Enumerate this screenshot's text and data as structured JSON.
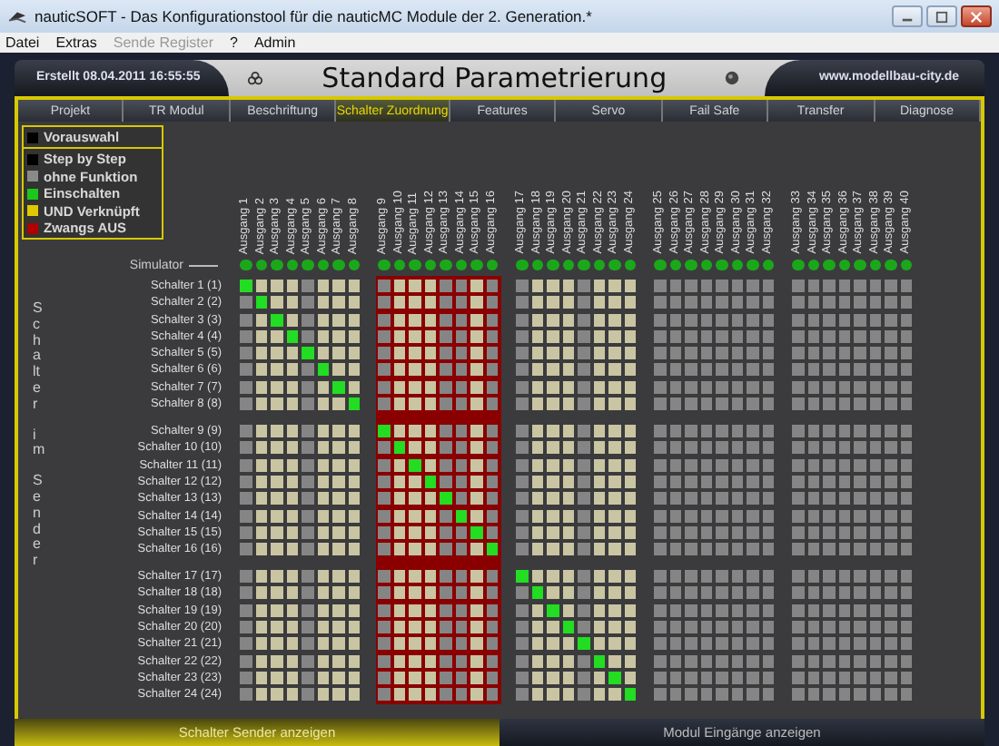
{
  "window": {
    "title": "nauticSOFT - Das Konfigurationstool für die nauticMC Module der 2. Generation.*"
  },
  "menu": [
    {
      "label": "Datei",
      "disabled": false
    },
    {
      "label": "Extras",
      "disabled": false
    },
    {
      "label": "Sende Register",
      "disabled": true
    },
    {
      "label": "?",
      "disabled": false
    },
    {
      "label": "Admin",
      "disabled": false
    }
  ],
  "header": {
    "created": "Erstellt 08.04.2011 16:55:55",
    "title": "Standard Parametrierung",
    "website": "www.modellbau-city.de"
  },
  "tabs": [
    {
      "label": "Projekt",
      "selected": false
    },
    {
      "label": "TR Modul",
      "selected": false
    },
    {
      "label": "Beschriftung",
      "selected": false
    },
    {
      "label": "Schalter Zuordnung",
      "selected": true
    },
    {
      "label": "Features",
      "selected": false
    },
    {
      "label": "Servo",
      "selected": false
    },
    {
      "label": "Fail Safe",
      "selected": false
    },
    {
      "label": "Transfer",
      "selected": false
    },
    {
      "label": "Diagnose",
      "selected": false
    }
  ],
  "legend_top": {
    "label": "Vorauswahl",
    "color": "#000000"
  },
  "legend": [
    {
      "label": "Step by Step",
      "color": "#000000"
    },
    {
      "label": "ohne Funktion",
      "color": "#8a8a8a"
    },
    {
      "label": "Einschalten",
      "color": "#19c819"
    },
    {
      "label": "UND Verknüpft",
      "color": "#e0c800"
    },
    {
      "label": "Zwangs AUS",
      "color": "#b00000"
    }
  ],
  "simulator_label": "Simulator",
  "side_label": [
    "Schalter",
    "im",
    "Sender"
  ],
  "column_groups": [
    {
      "forced_off": false,
      "columns": [
        {
          "label": "Ausgang 1",
          "enabled": false,
          "simulator_on": true
        },
        {
          "label": "Ausgang 2",
          "enabled": true,
          "simulator_on": true
        },
        {
          "label": "Ausgang 3",
          "enabled": true,
          "simulator_on": true
        },
        {
          "label": "Ausgang 4",
          "enabled": true,
          "simulator_on": true
        },
        {
          "label": "Ausgang 5",
          "enabled": false,
          "simulator_on": true
        },
        {
          "label": "Ausgang 6",
          "enabled": true,
          "simulator_on": true
        },
        {
          "label": "Ausgang 7",
          "enabled": true,
          "simulator_on": true
        },
        {
          "label": "Ausgang 8",
          "enabled": true,
          "simulator_on": true
        }
      ]
    },
    {
      "forced_off": true,
      "columns": [
        {
          "label": "Ausgang 9",
          "enabled": false,
          "simulator_on": true
        },
        {
          "label": "Ausgang 10",
          "enabled": true,
          "simulator_on": true
        },
        {
          "label": "Ausgang 11",
          "enabled": true,
          "simulator_on": true
        },
        {
          "label": "Ausgang 12",
          "enabled": true,
          "simulator_on": true
        },
        {
          "label": "Ausgang 13",
          "enabled": false,
          "simulator_on": true
        },
        {
          "label": "Ausgang 14",
          "enabled": false,
          "simulator_on": true
        },
        {
          "label": "Ausgang 15",
          "enabled": true,
          "simulator_on": true
        },
        {
          "label": "Ausgang 16",
          "enabled": false,
          "simulator_on": true
        }
      ]
    },
    {
      "forced_off": false,
      "columns": [
        {
          "label": "Ausgang 17",
          "enabled": false,
          "simulator_on": true
        },
        {
          "label": "Ausgang 18",
          "enabled": true,
          "simulator_on": true
        },
        {
          "label": "Ausgang 19",
          "enabled": true,
          "simulator_on": true
        },
        {
          "label": "Ausgang 20",
          "enabled": true,
          "simulator_on": true
        },
        {
          "label": "Ausgang 21",
          "enabled": false,
          "simulator_on": true
        },
        {
          "label": "Ausgang 22",
          "enabled": true,
          "simulator_on": true
        },
        {
          "label": "Ausgang 23",
          "enabled": true,
          "simulator_on": true
        },
        {
          "label": "Ausgang 24",
          "enabled": true,
          "simulator_on": true
        }
      ]
    },
    {
      "forced_off": false,
      "columns": [
        {
          "label": "Ausgang 25",
          "enabled": false,
          "simulator_on": true
        },
        {
          "label": "Ausgang 26",
          "enabled": false,
          "simulator_on": true
        },
        {
          "label": "Ausgang 27",
          "enabled": false,
          "simulator_on": true
        },
        {
          "label": "Ausgang 28",
          "enabled": false,
          "simulator_on": true
        },
        {
          "label": "Ausgang 29",
          "enabled": false,
          "simulator_on": true
        },
        {
          "label": "Ausgang 30",
          "enabled": false,
          "simulator_on": true
        },
        {
          "label": "Ausgang 31",
          "enabled": false,
          "simulator_on": true
        },
        {
          "label": "Ausgang 32",
          "enabled": false,
          "simulator_on": true
        }
      ]
    },
    {
      "forced_off": false,
      "columns": [
        {
          "label": "Ausgang 33",
          "enabled": false,
          "simulator_on": true
        },
        {
          "label": "Ausgang 34",
          "enabled": false,
          "simulator_on": true
        },
        {
          "label": "Ausgang 35",
          "enabled": false,
          "simulator_on": true
        },
        {
          "label": "Ausgang 36",
          "enabled": false,
          "simulator_on": true
        },
        {
          "label": "Ausgang 37",
          "enabled": false,
          "simulator_on": true
        },
        {
          "label": "Ausgang 38",
          "enabled": false,
          "simulator_on": true
        },
        {
          "label": "Ausgang 39",
          "enabled": false,
          "simulator_on": true
        },
        {
          "label": "Ausgang 40",
          "enabled": false,
          "simulator_on": true
        }
      ]
    }
  ],
  "row_groups": [
    {
      "rows": [
        {
          "label": "Schalter 1 (1)",
          "on": [
            true,
            false,
            false,
            false,
            false,
            false,
            false,
            false,
            false,
            false,
            false,
            false,
            false,
            false,
            false,
            false,
            false,
            false,
            false,
            false,
            false,
            false,
            false,
            false,
            false,
            false,
            false,
            false,
            false,
            false,
            false,
            false,
            false,
            false,
            false,
            false,
            false,
            false,
            false,
            false
          ]
        },
        {
          "label": "Schalter 2 (2)",
          "on": [
            false,
            true,
            false,
            false,
            false,
            false,
            false,
            false,
            false,
            false,
            false,
            false,
            false,
            false,
            false,
            false,
            false,
            false,
            false,
            false,
            false,
            false,
            false,
            false,
            false,
            false,
            false,
            false,
            false,
            false,
            false,
            false,
            false,
            false,
            false,
            false,
            false,
            false,
            false,
            false
          ]
        },
        {
          "label": "Schalter 3 (3)",
          "on": [
            false,
            false,
            true,
            false,
            false,
            false,
            false,
            false,
            false,
            false,
            false,
            false,
            false,
            false,
            false,
            false,
            false,
            false,
            false,
            false,
            false,
            false,
            false,
            false,
            false,
            false,
            false,
            false,
            false,
            false,
            false,
            false,
            false,
            false,
            false,
            false,
            false,
            false,
            false,
            false
          ]
        },
        {
          "label": "Schalter 4 (4)",
          "on": [
            false,
            false,
            false,
            true,
            false,
            false,
            false,
            false,
            false,
            false,
            false,
            false,
            false,
            false,
            false,
            false,
            false,
            false,
            false,
            false,
            false,
            false,
            false,
            false,
            false,
            false,
            false,
            false,
            false,
            false,
            false,
            false,
            false,
            false,
            false,
            false,
            false,
            false,
            false,
            false
          ]
        },
        {
          "label": "Schalter 5 (5)",
          "on": [
            false,
            false,
            false,
            false,
            true,
            false,
            false,
            false,
            false,
            false,
            false,
            false,
            false,
            false,
            false,
            false,
            false,
            false,
            false,
            false,
            false,
            false,
            false,
            false,
            false,
            false,
            false,
            false,
            false,
            false,
            false,
            false,
            false,
            false,
            false,
            false,
            false,
            false,
            false,
            false
          ]
        },
        {
          "label": "Schalter 6 (6)",
          "on": [
            false,
            false,
            false,
            false,
            false,
            true,
            false,
            false,
            false,
            false,
            false,
            false,
            false,
            false,
            false,
            false,
            false,
            false,
            false,
            false,
            false,
            false,
            false,
            false,
            false,
            false,
            false,
            false,
            false,
            false,
            false,
            false,
            false,
            false,
            false,
            false,
            false,
            false,
            false,
            false
          ]
        },
        {
          "label": "Schalter 7 (7)",
          "on": [
            false,
            false,
            false,
            false,
            false,
            false,
            true,
            false,
            false,
            false,
            false,
            false,
            false,
            false,
            false,
            false,
            false,
            false,
            false,
            false,
            false,
            false,
            false,
            false,
            false,
            false,
            false,
            false,
            false,
            false,
            false,
            false,
            false,
            false,
            false,
            false,
            false,
            false,
            false,
            false
          ]
        },
        {
          "label": "Schalter 8 (8)",
          "on": [
            false,
            false,
            false,
            false,
            false,
            false,
            false,
            true,
            false,
            false,
            false,
            false,
            false,
            false,
            false,
            false,
            false,
            false,
            false,
            false,
            false,
            false,
            false,
            false,
            false,
            false,
            false,
            false,
            false,
            false,
            false,
            false,
            false,
            false,
            false,
            false,
            false,
            false,
            false,
            false
          ]
        }
      ]
    },
    {
      "rows": [
        {
          "label": "Schalter 9 (9)",
          "on": [
            false,
            false,
            false,
            false,
            false,
            false,
            false,
            false,
            true,
            false,
            false,
            false,
            false,
            false,
            false,
            false,
            false,
            false,
            false,
            false,
            false,
            false,
            false,
            false,
            false,
            false,
            false,
            false,
            false,
            false,
            false,
            false,
            false,
            false,
            false,
            false,
            false,
            false,
            false,
            false
          ]
        },
        {
          "label": "Schalter 10 (10)",
          "on": [
            false,
            false,
            false,
            false,
            false,
            false,
            false,
            false,
            false,
            true,
            false,
            false,
            false,
            false,
            false,
            false,
            false,
            false,
            false,
            false,
            false,
            false,
            false,
            false,
            false,
            false,
            false,
            false,
            false,
            false,
            false,
            false,
            false,
            false,
            false,
            false,
            false,
            false,
            false,
            false
          ]
        },
        {
          "label": "Schalter 11 (11)",
          "on": [
            false,
            false,
            false,
            false,
            false,
            false,
            false,
            false,
            false,
            false,
            true,
            false,
            false,
            false,
            false,
            false,
            false,
            false,
            false,
            false,
            false,
            false,
            false,
            false,
            false,
            false,
            false,
            false,
            false,
            false,
            false,
            false,
            false,
            false,
            false,
            false,
            false,
            false,
            false,
            false
          ]
        },
        {
          "label": "Schalter 12 (12)",
          "on": [
            false,
            false,
            false,
            false,
            false,
            false,
            false,
            false,
            false,
            false,
            false,
            true,
            false,
            false,
            false,
            false,
            false,
            false,
            false,
            false,
            false,
            false,
            false,
            false,
            false,
            false,
            false,
            false,
            false,
            false,
            false,
            false,
            false,
            false,
            false,
            false,
            false,
            false,
            false,
            false
          ]
        },
        {
          "label": "Schalter 13 (13)",
          "on": [
            false,
            false,
            false,
            false,
            false,
            false,
            false,
            false,
            false,
            false,
            false,
            false,
            true,
            false,
            false,
            false,
            false,
            false,
            false,
            false,
            false,
            false,
            false,
            false,
            false,
            false,
            false,
            false,
            false,
            false,
            false,
            false,
            false,
            false,
            false,
            false,
            false,
            false,
            false,
            false
          ]
        },
        {
          "label": "Schalter 14 (14)",
          "on": [
            false,
            false,
            false,
            false,
            false,
            false,
            false,
            false,
            false,
            false,
            false,
            false,
            false,
            true,
            false,
            false,
            false,
            false,
            false,
            false,
            false,
            false,
            false,
            false,
            false,
            false,
            false,
            false,
            false,
            false,
            false,
            false,
            false,
            false,
            false,
            false,
            false,
            false,
            false,
            false
          ]
        },
        {
          "label": "Schalter 15 (15)",
          "on": [
            false,
            false,
            false,
            false,
            false,
            false,
            false,
            false,
            false,
            false,
            false,
            false,
            false,
            false,
            true,
            false,
            false,
            false,
            false,
            false,
            false,
            false,
            false,
            false,
            false,
            false,
            false,
            false,
            false,
            false,
            false,
            false,
            false,
            false,
            false,
            false,
            false,
            false,
            false,
            false
          ]
        },
        {
          "label": "Schalter 16 (16)",
          "on": [
            false,
            false,
            false,
            false,
            false,
            false,
            false,
            false,
            false,
            false,
            false,
            false,
            false,
            false,
            false,
            true,
            false,
            false,
            false,
            false,
            false,
            false,
            false,
            false,
            false,
            false,
            false,
            false,
            false,
            false,
            false,
            false,
            false,
            false,
            false,
            false,
            false,
            false,
            false,
            false
          ]
        }
      ]
    },
    {
      "rows": [
        {
          "label": "Schalter 17 (17)",
          "on": [
            false,
            false,
            false,
            false,
            false,
            false,
            false,
            false,
            false,
            false,
            false,
            false,
            false,
            false,
            false,
            false,
            true,
            false,
            false,
            false,
            false,
            false,
            false,
            false,
            false,
            false,
            false,
            false,
            false,
            false,
            false,
            false,
            false,
            false,
            false,
            false,
            false,
            false,
            false,
            false
          ]
        },
        {
          "label": "Schalter 18 (18)",
          "on": [
            false,
            false,
            false,
            false,
            false,
            false,
            false,
            false,
            false,
            false,
            false,
            false,
            false,
            false,
            false,
            false,
            false,
            true,
            false,
            false,
            false,
            false,
            false,
            false,
            false,
            false,
            false,
            false,
            false,
            false,
            false,
            false,
            false,
            false,
            false,
            false,
            false,
            false,
            false,
            false
          ]
        },
        {
          "label": "Schalter 19 (19)",
          "on": [
            false,
            false,
            false,
            false,
            false,
            false,
            false,
            false,
            false,
            false,
            false,
            false,
            false,
            false,
            false,
            false,
            false,
            false,
            true,
            false,
            false,
            false,
            false,
            false,
            false,
            false,
            false,
            false,
            false,
            false,
            false,
            false,
            false,
            false,
            false,
            false,
            false,
            false,
            false,
            false
          ]
        },
        {
          "label": "Schalter 20 (20)",
          "on": [
            false,
            false,
            false,
            false,
            false,
            false,
            false,
            false,
            false,
            false,
            false,
            false,
            false,
            false,
            false,
            false,
            false,
            false,
            false,
            true,
            false,
            false,
            false,
            false,
            false,
            false,
            false,
            false,
            false,
            false,
            false,
            false,
            false,
            false,
            false,
            false,
            false,
            false,
            false,
            false
          ]
        },
        {
          "label": "Schalter 21 (21)",
          "on": [
            false,
            false,
            false,
            false,
            false,
            false,
            false,
            false,
            false,
            false,
            false,
            false,
            false,
            false,
            false,
            false,
            false,
            false,
            false,
            false,
            true,
            false,
            false,
            false,
            false,
            false,
            false,
            false,
            false,
            false,
            false,
            false,
            false,
            false,
            false,
            false,
            false,
            false,
            false,
            false
          ]
        },
        {
          "label": "Schalter 22 (22)",
          "on": [
            false,
            false,
            false,
            false,
            false,
            false,
            false,
            false,
            false,
            false,
            false,
            false,
            false,
            false,
            false,
            false,
            false,
            false,
            false,
            false,
            false,
            true,
            false,
            false,
            false,
            false,
            false,
            false,
            false,
            false,
            false,
            false,
            false,
            false,
            false,
            false,
            false,
            false,
            false,
            false
          ]
        },
        {
          "label": "Schalter 23 (23)",
          "on": [
            false,
            false,
            false,
            false,
            false,
            false,
            false,
            false,
            false,
            false,
            false,
            false,
            false,
            false,
            false,
            false,
            false,
            false,
            false,
            false,
            false,
            false,
            true,
            false,
            false,
            false,
            false,
            false,
            false,
            false,
            false,
            false,
            false,
            false,
            false,
            false,
            false,
            false,
            false,
            false
          ]
        },
        {
          "label": "Schalter 24 (24)",
          "on": [
            false,
            false,
            false,
            false,
            false,
            false,
            false,
            false,
            false,
            false,
            false,
            false,
            false,
            false,
            false,
            false,
            false,
            false,
            false,
            false,
            false,
            false,
            false,
            true,
            false,
            false,
            false,
            false,
            false,
            false,
            false,
            false,
            false,
            false,
            false,
            false,
            false,
            false,
            false,
            false
          ]
        }
      ]
    }
  ],
  "bottom_tabs": [
    {
      "label": "Schalter Sender anzeigen",
      "selected": true
    },
    {
      "label": "Modul Eingänge anzeigen",
      "selected": false
    }
  ]
}
